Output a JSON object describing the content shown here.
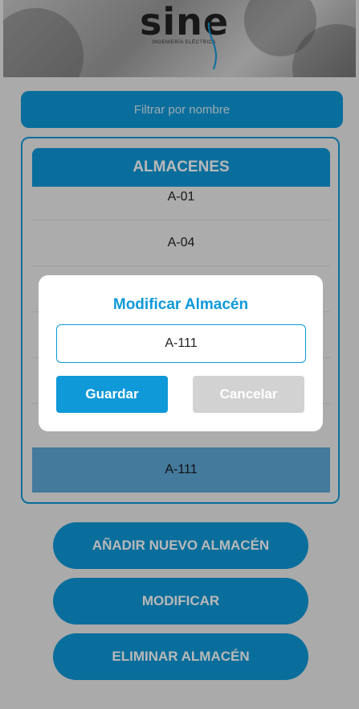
{
  "header": {
    "logo_text": "sine",
    "logo_subtitle": "INGENIERÍA ELÉCTRICA"
  },
  "filter": {
    "placeholder": "Filtrar por nombre"
  },
  "panel": {
    "title": "ALMACENES",
    "rows": [
      "A-01",
      "A-04",
      "",
      "",
      "",
      "A-111"
    ],
    "selected_row": "A-111"
  },
  "buttons": {
    "add": "AÑADIR NUEVO ALMACÉN",
    "modify": "MODIFICAR",
    "delete": "ELIMINAR ALMACÉN"
  },
  "dialog": {
    "title": "Modificar Almacén",
    "input_value": "A-111",
    "save_label": "Guardar",
    "cancel_label": "Cancelar"
  },
  "colors": {
    "accent": "#0f99d9",
    "selected_row": "#5fa9d8",
    "cancel": "#d2d2d2"
  }
}
